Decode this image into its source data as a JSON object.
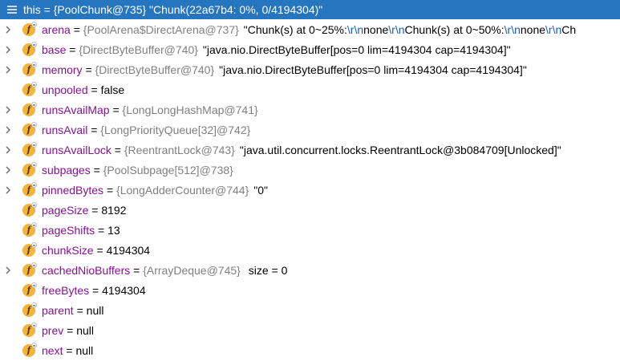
{
  "header": {
    "text": "this = {PoolChunk@735} \"Chunk(22a67b4: 0%, 0/4194304)\""
  },
  "fields": [
    {
      "name": "arena",
      "ref": "{PoolArena$DirectArena@737}",
      "segments": [
        {
          "t": "\"Chunk(s) at 0~25%:",
          "esc": false
        },
        {
          "t": "\\r\\n",
          "esc": true
        },
        {
          "t": "none",
          "esc": false
        },
        {
          "t": "\\r\\n",
          "esc": true
        },
        {
          "t": "Chunk(s) at 0~50%:",
          "esc": false
        },
        {
          "t": "\\r\\n",
          "esc": true
        },
        {
          "t": "none",
          "esc": false
        },
        {
          "t": "\\r\\n",
          "esc": true
        },
        {
          "t": "Ch",
          "esc": false
        }
      ],
      "expandable": true
    },
    {
      "name": "base",
      "ref": "{DirectByteBuffer@740}",
      "value": "\"java.nio.DirectByteBuffer[pos=0 lim=4194304 cap=4194304]\"",
      "expandable": true
    },
    {
      "name": "memory",
      "ref": "{DirectByteBuffer@740}",
      "value": "\"java.nio.DirectByteBuffer[pos=0 lim=4194304 cap=4194304]\"",
      "expandable": true
    },
    {
      "name": "unpooled",
      "value": "false",
      "expandable": false
    },
    {
      "name": "runsAvailMap",
      "ref": "{LongLongHashMap@741}",
      "expandable": true
    },
    {
      "name": "runsAvail",
      "ref": "{LongPriorityQueue[32]@742}",
      "expandable": true
    },
    {
      "name": "runsAvailLock",
      "ref": "{ReentrantLock@743}",
      "value": "\"java.util.concurrent.locks.ReentrantLock@3b084709[Unlocked]\"",
      "expandable": true
    },
    {
      "name": "subpages",
      "ref": "{PoolSubpage[512]@738}",
      "expandable": true
    },
    {
      "name": "pinnedBytes",
      "ref": "{LongAdderCounter@744}",
      "value": "\"0\"",
      "expandable": true
    },
    {
      "name": "pageSize",
      "value": "8192",
      "expandable": false
    },
    {
      "name": "pageShifts",
      "value": "13",
      "expandable": false
    },
    {
      "name": "chunkSize",
      "value": "4194304",
      "expandable": false
    },
    {
      "name": "cachedNioBuffers",
      "ref": "{ArrayDeque@745}",
      "value": " size = 0",
      "expandable": true
    },
    {
      "name": "freeBytes",
      "value": "4194304",
      "expandable": false
    },
    {
      "name": "parent",
      "value": "null",
      "expandable": false
    },
    {
      "name": "prev",
      "value": "null",
      "expandable": false
    },
    {
      "name": "next",
      "value": "null",
      "expandable": false
    }
  ],
  "icons": {
    "header": "fields-list-icon",
    "field": "field-icon",
    "expand": "chevron-right-icon"
  },
  "colors": {
    "header_bg": "#2675bf",
    "field_name": "#871094",
    "ref_text": "#808080",
    "escape_text": "#1a5cb6",
    "field_icon": "#f2b43c"
  },
  "labels": {
    "equals": " = ",
    "field_icon_letter": "f"
  }
}
